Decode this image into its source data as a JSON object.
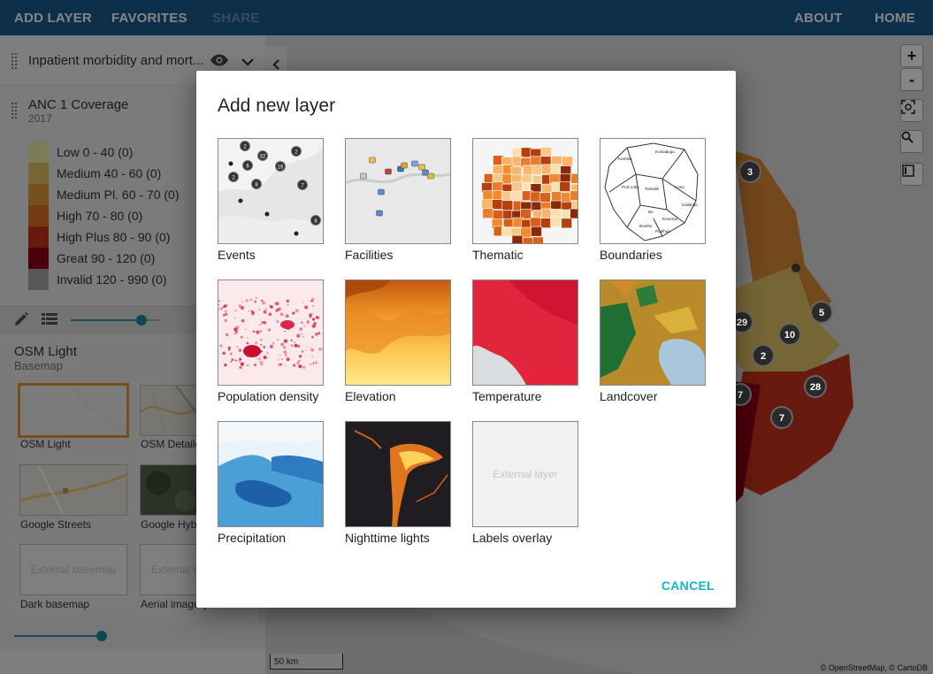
{
  "topbar": {
    "add_layer": "ADD LAYER",
    "favorites": "FAVORITES",
    "share": "SHARE",
    "about": "ABOUT",
    "home": "HOME"
  },
  "panel": {
    "layer1": {
      "title": "Inpatient morbidity and mort..."
    },
    "layer2": {
      "title": "ANC 1 Coverage",
      "period": "2017",
      "legend": [
        {
          "label": "Low 0 - 40 (0)",
          "color": "#ecebaa"
        },
        {
          "label": "Medium 40 - 60 (0)",
          "color": "#e3c468"
        },
        {
          "label": "Medium Pl. 60 - 70 (0)",
          "color": "#e29a35"
        },
        {
          "label": "High 70 - 80 (0)",
          "color": "#de6f24"
        },
        {
          "label": "High Plus 80 - 90 (0)",
          "color": "#c9321b"
        },
        {
          "label": "Great 90 - 120 (0)",
          "color": "#900015"
        },
        {
          "label": "Invalid 120 - 990 (0)",
          "color": "#aaaaaa"
        }
      ]
    },
    "basemap": {
      "title": "OSM Light",
      "subtitle": "Basemap",
      "items": [
        {
          "label": "OSM Light"
        },
        {
          "label": "OSM Detailed"
        },
        {
          "label": "Google Streets"
        },
        {
          "label": "Google Hybrid"
        },
        {
          "label": "Dark basemap",
          "placeholder": "External basemap"
        },
        {
          "label": "Aerial imagery",
          "placeholder": "External b"
        }
      ]
    }
  },
  "map": {
    "zoom_in": "+",
    "zoom_out": "-",
    "scale": "50 km",
    "attribution": "© OpenStreetMap, © CartoDB",
    "clusters": [
      "3",
      "29",
      "5",
      "10",
      "2",
      "28",
      "7",
      "7"
    ]
  },
  "dialog": {
    "title": "Add new layer",
    "tiles": [
      {
        "label": "Events",
        "thumb": "events"
      },
      {
        "label": "Facilities",
        "thumb": "facilities"
      },
      {
        "label": "Thematic",
        "thumb": "thematic"
      },
      {
        "label": "Boundaries",
        "thumb": "boundaries"
      },
      {
        "label": "Population density",
        "thumb": "population"
      },
      {
        "label": "Elevation",
        "thumb": "elevation"
      },
      {
        "label": "Temperature",
        "thumb": "temperature"
      },
      {
        "label": "Landcover",
        "thumb": "landcover"
      },
      {
        "label": "Precipitation",
        "thumb": "precipitation"
      },
      {
        "label": "Nighttime lights",
        "thumb": "nightlights"
      },
      {
        "label": "Labels overlay",
        "thumb": "labels",
        "placeholder": "External layer"
      }
    ],
    "boundary_names": [
      "Kambia",
      "Koinadugu",
      "Port Loko",
      "Tonkolili",
      "Kono",
      "Kailahun",
      "Bo",
      "Kenema",
      "Bonthe",
      "Pujehun"
    ],
    "cancel": "CANCEL"
  }
}
